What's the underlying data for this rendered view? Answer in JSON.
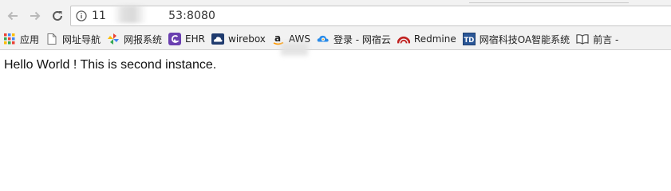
{
  "toolbar": {
    "back_icon": "arrow-left-icon",
    "forward_icon": "arrow-right-icon",
    "reload_icon": "reload-icon"
  },
  "address_bar": {
    "info_icon": "info-circle-icon",
    "url": "11           53:8080"
  },
  "bookmarks": [
    {
      "label": "应用",
      "icon": "apps-grid-icon"
    },
    {
      "label": "网址导航",
      "icon": "page-icon"
    },
    {
      "label": "网报系统",
      "icon": "pinwheel-icon"
    },
    {
      "label": "EHR",
      "icon": "ehr-logo-icon"
    },
    {
      "label": "wirebox",
      "icon": "cloud-icon"
    },
    {
      "label": "AWS",
      "icon": "amazon-icon"
    },
    {
      "label": "登录 - 网宿云",
      "icon": "wangsu-cloud-icon"
    },
    {
      "label": "Redmine",
      "icon": "redmine-icon"
    },
    {
      "label": "网宿科技OA智能系统",
      "icon": "td-icon"
    },
    {
      "label": "前言 -",
      "icon": "book-icon"
    }
  ],
  "colors": {
    "chrome_bg": "#f2f2f2",
    "page_bg": "#ffffff",
    "text": "#111111"
  },
  "page": {
    "body_text": "Hello World ! This is second instance."
  }
}
